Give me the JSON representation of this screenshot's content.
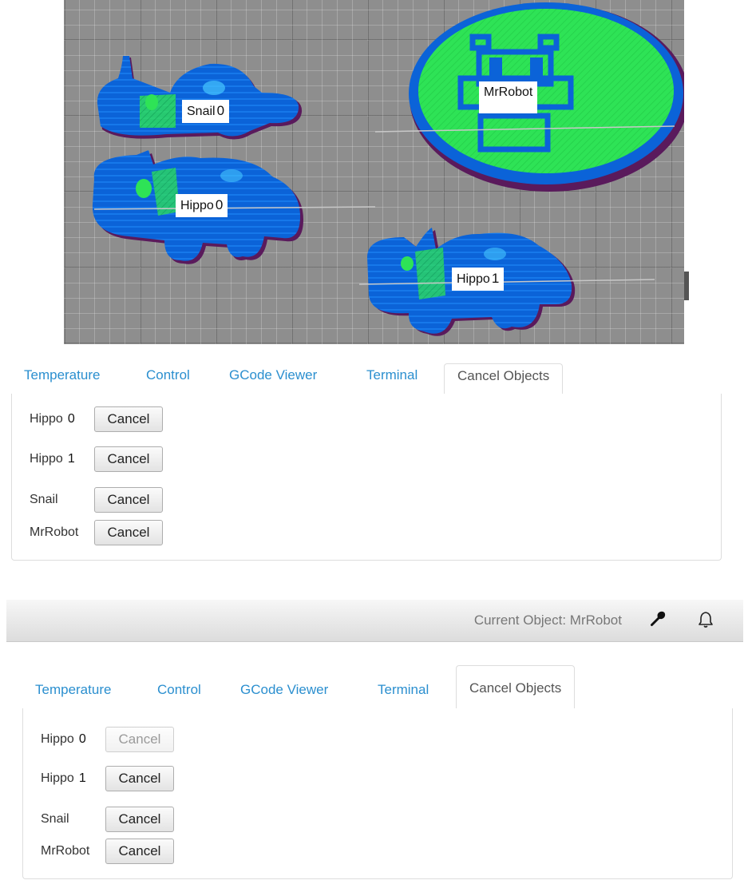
{
  "preview": {
    "objects": [
      {
        "name": "Snail",
        "index": "0"
      },
      {
        "name": "MrRobot",
        "index": ""
      },
      {
        "name": "Hippo",
        "index": "0"
      },
      {
        "name": "Hippo",
        "index": "1"
      }
    ],
    "colors": {
      "plate": "#8e8e8e",
      "perimeter": "#0a5fd6",
      "infill": "#22e04a",
      "brim": "#5a1a5c"
    }
  },
  "panel1": {
    "tabs": [
      "Temperature",
      "Control",
      "GCode Viewer",
      "Terminal",
      "Cancel Objects"
    ],
    "active_tab": "Cancel Objects",
    "rows": [
      {
        "name": "Hippo",
        "index": "0",
        "button": "Cancel",
        "disabled": false
      },
      {
        "name": "Hippo",
        "index": "1",
        "button": "Cancel",
        "disabled": false
      },
      {
        "name": "Snail",
        "index": "",
        "button": "Cancel",
        "disabled": false
      },
      {
        "name": "MrRobot",
        "index": "",
        "button": "Cancel",
        "disabled": false
      }
    ]
  },
  "navbar": {
    "current_object": "Current Object: MrRobot",
    "icons": [
      "wrench-icon",
      "bell-icon"
    ]
  },
  "panel2": {
    "tabs": [
      "Temperature",
      "Control",
      "GCode Viewer",
      "Terminal",
      "Cancel Objects"
    ],
    "active_tab": "Cancel Objects",
    "rows": [
      {
        "name": "Hippo",
        "index": "0",
        "button": "Cancel",
        "disabled": true
      },
      {
        "name": "Hippo",
        "index": "1",
        "button": "Cancel",
        "disabled": false
      },
      {
        "name": "Snail",
        "index": "",
        "button": "Cancel",
        "disabled": false
      },
      {
        "name": "MrRobot",
        "index": "",
        "button": "Cancel",
        "disabled": false
      }
    ]
  },
  "theme": {
    "link": "#2b8fcf",
    "muted": "#777777"
  }
}
